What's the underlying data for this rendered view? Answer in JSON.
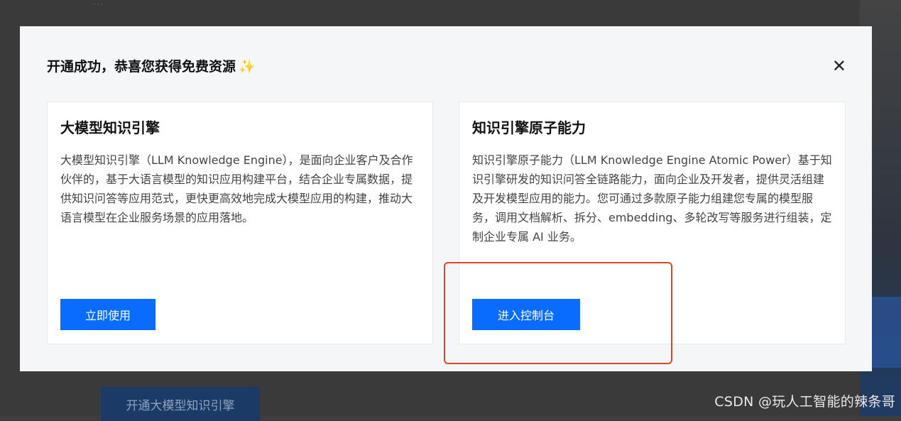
{
  "background": {
    "top_text": "…",
    "button_label": "开通大模型知识引擎",
    "watermark": "CSDN @玩人工智能的辣条哥"
  },
  "modal": {
    "title": "开通成功，恭喜您获得免费资源",
    "title_icon": "✨",
    "close_icon": "✕",
    "cards": [
      {
        "title": "大模型知识引擎",
        "description": "大模型知识引擎（LLM Knowledge Engine），是面向企业客户及合作伙伴的，基于大语言模型的知识应用构建平台，结合企业专属数据，提供知识问答等应用范式，更快更高效地完成大模型应用的构建，推动大语言模型在企业服务场景的应用落地。",
        "button_label": "立即使用"
      },
      {
        "title": "知识引擎原子能力",
        "description": "知识引擎原子能力（LLM Knowledge Engine Atomic Power）基于知识引擎研发的知识问答全链路能力，面向企业及开发者，提供灵活组建及开发模型应用的能力。您可通过多款原子能力组建您专属的模型服务，调用文档解析、拆分、embedding、多轮改写等服务进行组装，定制企业专属 AI 业务。",
        "button_label": "进入控制台"
      }
    ]
  },
  "colors": {
    "primary": "#0a6cff",
    "highlight_border": "#e0442c"
  }
}
